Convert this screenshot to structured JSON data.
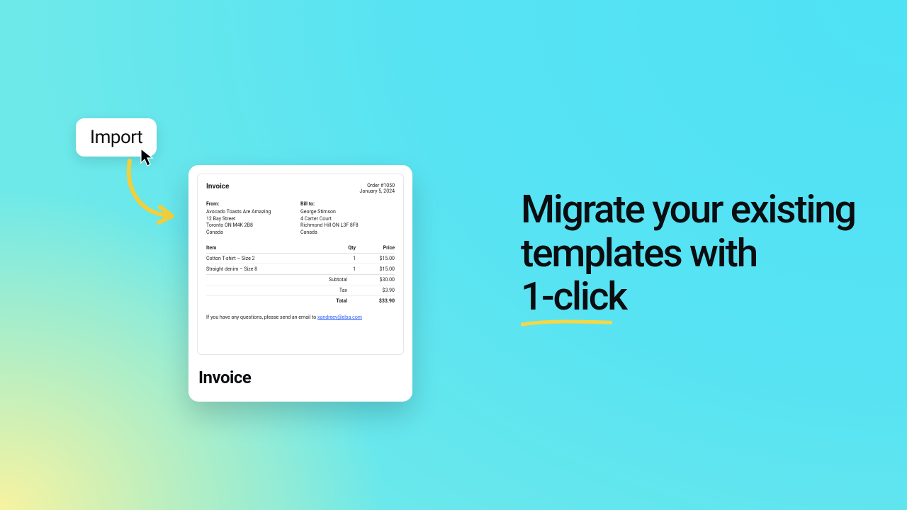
{
  "import_button": {
    "label": "Import"
  },
  "card": {
    "doc": {
      "title": "Invoice",
      "order_no": "Order #1050",
      "date": "January 5, 2024",
      "from": {
        "heading": "From:",
        "line1": "Avocado Toasts Are Amazing",
        "line2": "12 Bay Street",
        "line3": "Toronto ON M4K 2B8",
        "line4": "Canada"
      },
      "bill_to": {
        "heading": "Bill to:",
        "line1": "George Stimson",
        "line2": "4 Carter Court",
        "line3": "Richmond Hill ON L3F 8F8",
        "line4": "Canada"
      },
      "table": {
        "head_item": "Item",
        "head_qty": "Qty",
        "head_price": "Price",
        "rows": [
          {
            "item": "Cotton T-shirt – Size 2",
            "qty": "1",
            "price": "$15.00"
          },
          {
            "item": "Straight denim – Size 8",
            "qty": "1",
            "price": "$15.00"
          }
        ]
      },
      "totals": {
        "subtotal_label": "Subtotal",
        "subtotal": "$30.00",
        "tax_label": "Tax",
        "tax": "$3.90",
        "total_label": "Total",
        "total": "$33.90"
      },
      "footer_prefix": "If you have any questions, please send an email to ",
      "footer_email": "xandreev@elsa.com"
    },
    "caption": "Invoice"
  },
  "headline": {
    "line1": "Migrate your existing",
    "line2": "templates with",
    "accent": "1-click"
  }
}
